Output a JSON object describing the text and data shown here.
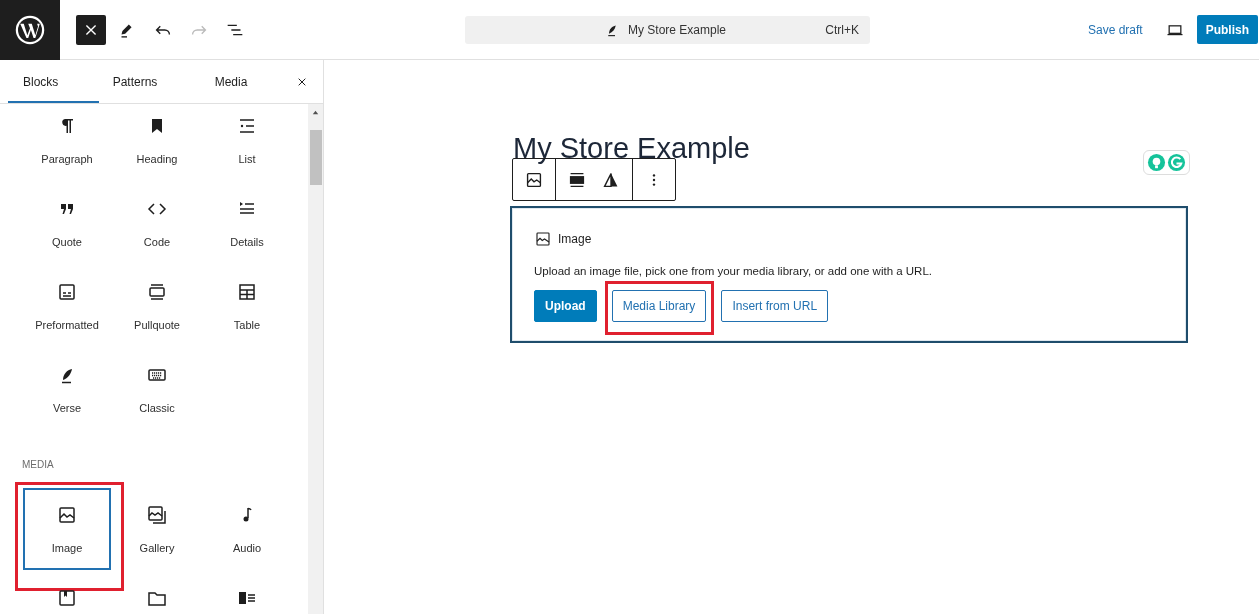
{
  "top_bar": {
    "toolbar_buttons": [
      {
        "kind": "inserter",
        "pressed": true,
        "disabled": false
      },
      {
        "kind": "tools",
        "pressed": false,
        "disabled": false
      },
      {
        "kind": "undo",
        "pressed": false,
        "disabled": false
      },
      {
        "kind": "redo",
        "pressed": false,
        "disabled": true
      },
      {
        "kind": "list-view",
        "pressed": false,
        "disabled": false
      }
    ],
    "command_bar": {
      "title": "My Store Example",
      "shortcut": "Ctrl+K"
    },
    "save_draft": "Save draft",
    "publish": "Publish"
  },
  "inserter": {
    "tabs": [
      {
        "label": "Blocks",
        "selected": true
      },
      {
        "label": "Patterns",
        "selected": false
      },
      {
        "label": "Media",
        "selected": false
      }
    ],
    "blocks": [
      {
        "label": "Paragraph",
        "selected": false,
        "highlighted": false
      },
      {
        "label": "Heading",
        "selected": false,
        "highlighted": false
      },
      {
        "label": "List",
        "selected": false,
        "highlighted": false
      },
      {
        "label": "Quote",
        "selected": false,
        "highlighted": false
      },
      {
        "label": "Code",
        "selected": false,
        "highlighted": false
      },
      {
        "label": "Details",
        "selected": false,
        "highlighted": false
      },
      {
        "label": "Preformatted",
        "selected": false,
        "highlighted": false
      },
      {
        "label": "Pullquote",
        "selected": false,
        "highlighted": false
      },
      {
        "label": "Table",
        "selected": false,
        "highlighted": false
      },
      {
        "label": "Verse",
        "selected": false,
        "highlighted": false
      },
      {
        "label": "Classic",
        "selected": false,
        "highlighted": false
      }
    ],
    "media_heading": "MEDIA",
    "media_blocks": [
      {
        "label": "Image",
        "selected": true,
        "highlighted": true
      },
      {
        "label": "Gallery",
        "selected": false,
        "highlighted": false
      },
      {
        "label": "Audio",
        "selected": false,
        "highlighted": false
      },
      {
        "selected": false,
        "highlighted": false
      },
      {
        "selected": false,
        "highlighted": false
      },
      {
        "selected": false,
        "highlighted": false
      }
    ]
  },
  "editor": {
    "title": "My Store Example",
    "image_block": {
      "label": "Image",
      "instructions": "Upload an image file, pick one from your media library, or add one with a URL.",
      "buttons": [
        {
          "label": "Upload",
          "kind": "primary",
          "highlighted": false
        },
        {
          "label": "Media Library",
          "kind": "secondary",
          "highlighted": true
        },
        {
          "label": "Insert from URL",
          "kind": "secondary",
          "highlighted": false
        }
      ]
    }
  }
}
